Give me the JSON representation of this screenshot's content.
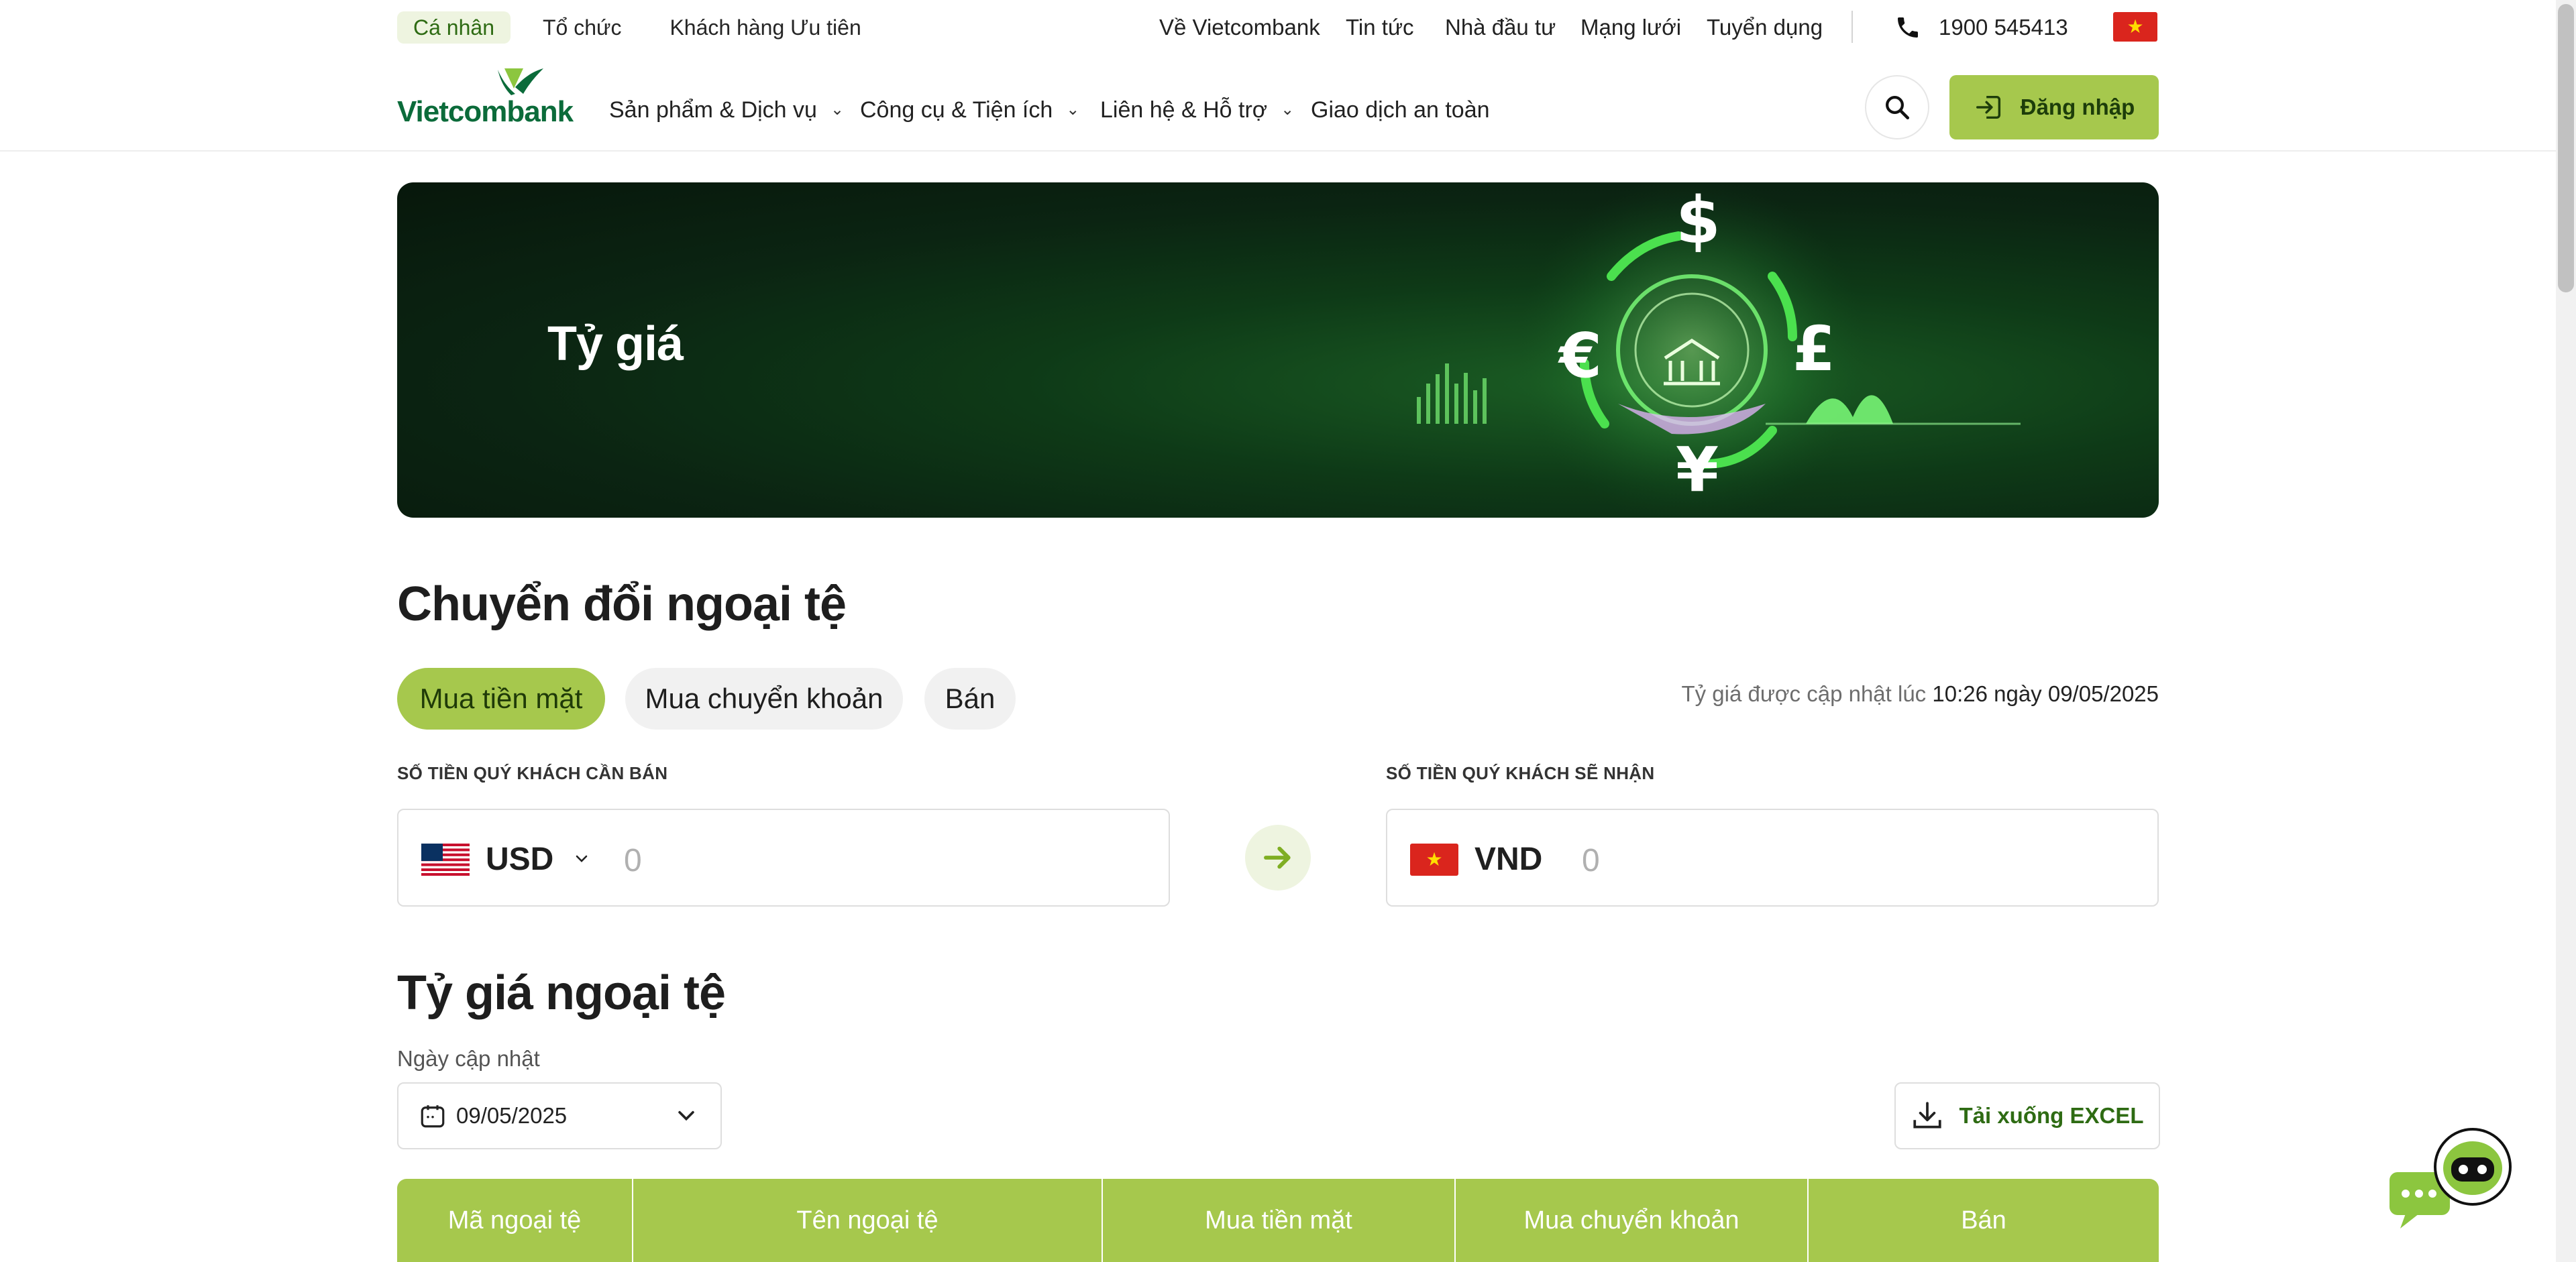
{
  "topbar": {
    "segments": [
      "Cá nhân",
      "Tổ chức",
      "Khách hàng Ưu tiên"
    ],
    "links": [
      "Về Vietcombank",
      "Tin tức",
      "Nhà đầu tư",
      "Mạng lưới",
      "Tuyển dụng"
    ],
    "hotline": "1900 545413",
    "language_flag": "vn-flag-icon"
  },
  "header": {
    "logo_text": "Vietcombank",
    "nav": [
      "Sản phẩm & Dịch vụ",
      "Công cụ & Tiện ích",
      "Liên hệ & Hỗ trợ",
      "Giao dịch an toàn"
    ],
    "login_label": "Đăng nhập"
  },
  "hero": {
    "title": "Tỷ giá"
  },
  "converter": {
    "heading": "Chuyển đổi ngoại tệ",
    "tabs": [
      "Mua tiền mặt",
      "Mua chuyển khoản",
      "Bán"
    ],
    "active_tab": "Mua tiền mặt",
    "update_prefix": "Tỷ giá được cập nhật lúc",
    "update_time": "10:26 ngày 09/05/2025",
    "sell_label": "SỐ TIỀN QUÝ KHÁCH CẦN BÁN",
    "receive_label": "SỐ TIỀN QUÝ KHÁCH SẼ NHẬN",
    "from_currency": "USD",
    "to_currency": "VND",
    "from_amount": "0",
    "to_amount": "0"
  },
  "rates": {
    "heading": "Tỷ giá ngoại tệ",
    "date_label": "Ngày cập nhật",
    "date_value": "09/05/2025",
    "download_label": "Tải xuống EXCEL",
    "columns": [
      "Mã ngoại tệ",
      "Tên ngoại tệ",
      "Mua tiền mặt",
      "Mua chuyển khoản",
      "Bán"
    ]
  },
  "colors": {
    "accent": "#a6c84d",
    "accent_light": "#eef4e0",
    "brand_green": "#0b6b3a"
  }
}
